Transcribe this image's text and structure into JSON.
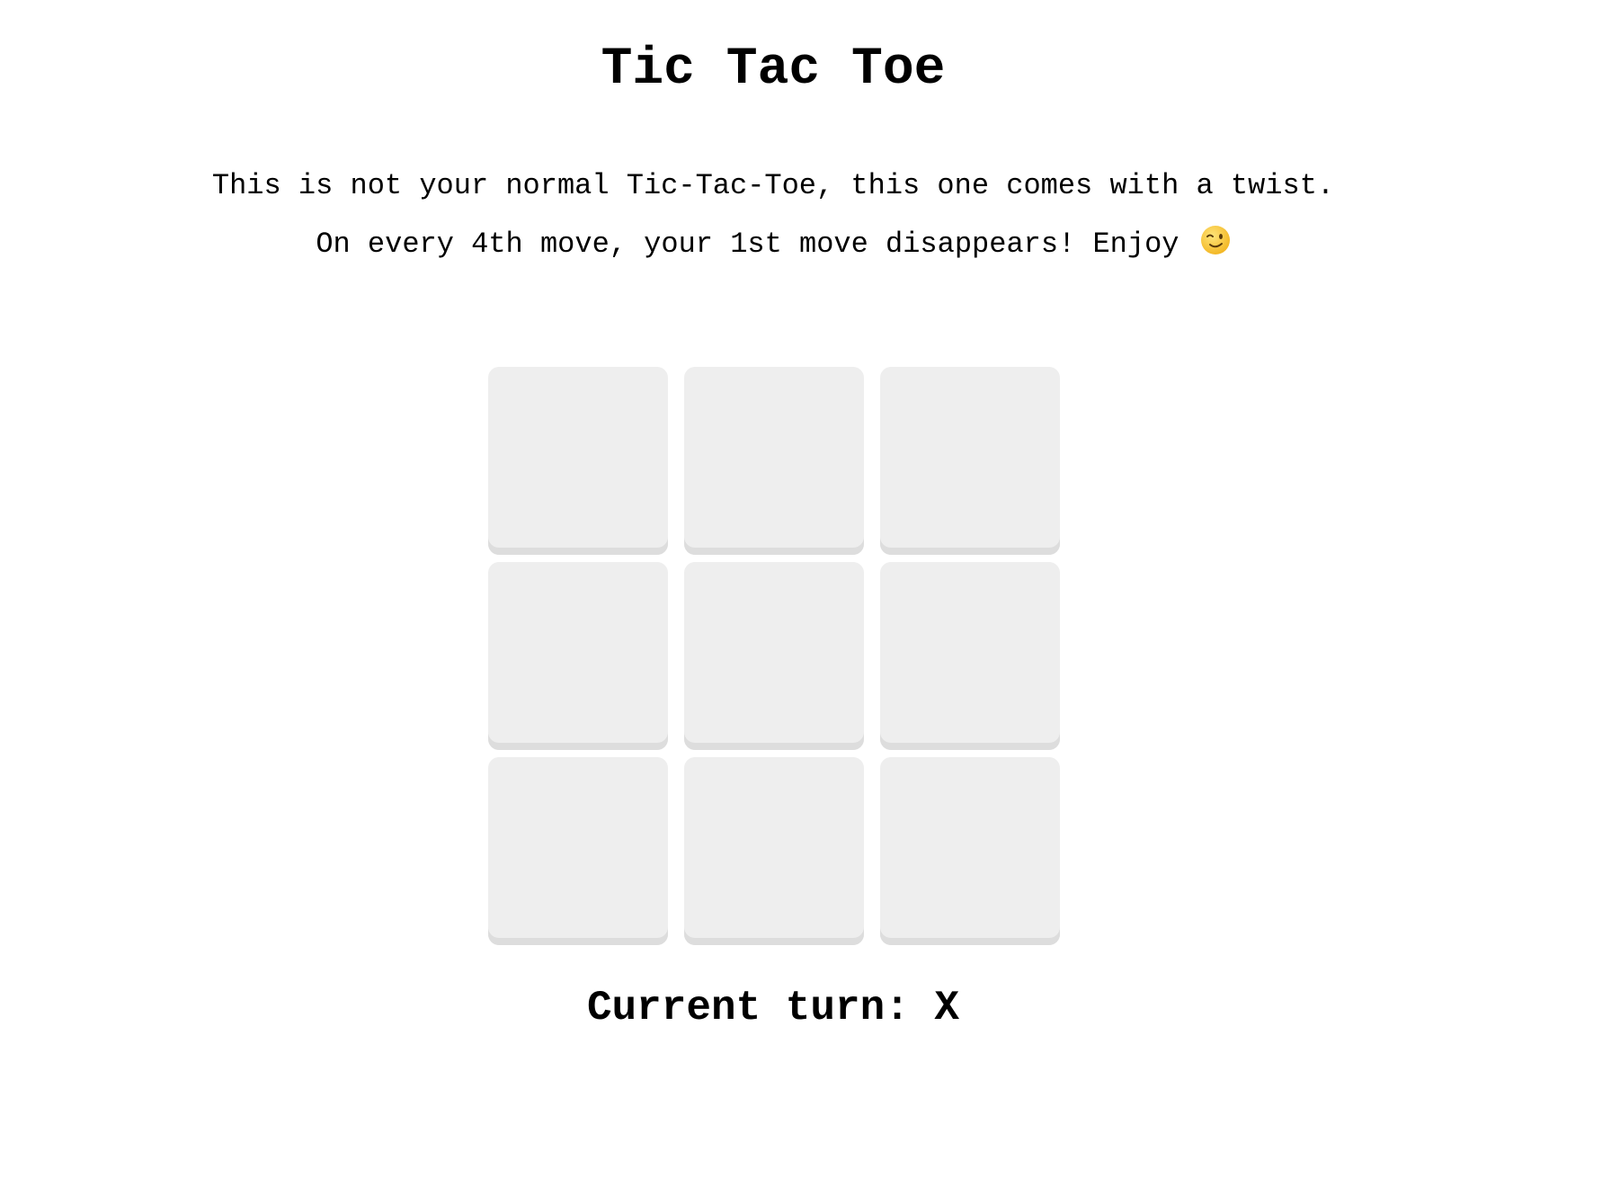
{
  "header": {
    "title": "Tic Tac Toe"
  },
  "description": {
    "line1": "This is not your normal Tic-Tac-Toe, this one comes with a twist.",
    "line2": "On every 4th move, your 1st move disappears! Enjoy",
    "emoji_icon": "winking-face-icon"
  },
  "board": {
    "cells": [
      "",
      "",
      "",
      "",
      "",
      "",
      "",
      "",
      ""
    ]
  },
  "status": {
    "text": "Current turn: X"
  },
  "colors": {
    "cell_background": "#eeeeee",
    "cell_shadow": "#dddddd",
    "emoji_face": "#f6c338"
  }
}
